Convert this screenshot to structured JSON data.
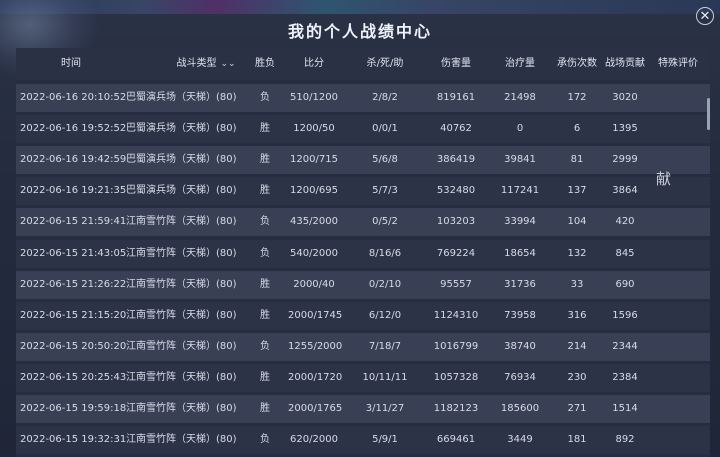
{
  "window": {
    "title": "我的个人战绩中心",
    "close_label": "✕"
  },
  "table": {
    "columns": {
      "time": "时间",
      "type": "战斗类型",
      "result": "胜负",
      "score": "比分",
      "kda": "杀/死/助",
      "damage": "伤害量",
      "heal": "治疗量",
      "taken": "承伤次数",
      "contribution": "战场贡献",
      "special": "特殊评价"
    },
    "sort_icon": "chevron-down-double-icon",
    "rows": [
      {
        "time": "2022-06-16 20:10:52",
        "type": "巴蜀演兵场（天梯）(80)",
        "result": "负",
        "score": "510/1200",
        "kda": "2/8/2",
        "damage": "819161",
        "heal": "21498",
        "taken": "172",
        "contribution": "3020",
        "special": ""
      },
      {
        "time": "2022-06-16 19:52:52",
        "type": "巴蜀演兵场（天梯）(80)",
        "result": "胜",
        "score": "1200/50",
        "kda": "0/0/1",
        "damage": "40762",
        "heal": "0",
        "taken": "6",
        "contribution": "1395",
        "special": ""
      },
      {
        "time": "2022-06-16 19:42:59",
        "type": "巴蜀演兵场（天梯）(80)",
        "result": "胜",
        "score": "1200/715",
        "kda": "5/6/8",
        "damage": "386419",
        "heal": "39841",
        "taken": "81",
        "contribution": "2999",
        "special": ""
      },
      {
        "time": "2022-06-16 19:21:35",
        "type": "巴蜀演兵场（天梯）(80)",
        "result": "胜",
        "score": "1200/695",
        "kda": "5/7/3",
        "damage": "532480",
        "heal": "117241",
        "taken": "137",
        "contribution": "3864",
        "special": ""
      },
      {
        "time": "2022-06-15 21:59:41",
        "type": "江南雪竹阵（天梯）(80)",
        "result": "负",
        "score": "435/2000",
        "kda": "0/5/2",
        "damage": "103203",
        "heal": "33994",
        "taken": "104",
        "contribution": "420",
        "special": ""
      },
      {
        "time": "2022-06-15 21:43:05",
        "type": "江南雪竹阵（天梯）(80)",
        "result": "负",
        "score": "540/2000",
        "kda": "8/16/6",
        "damage": "769224",
        "heal": "18654",
        "taken": "132",
        "contribution": "845",
        "special": ""
      },
      {
        "time": "2022-06-15 21:26:22",
        "type": "江南雪竹阵（天梯）(80)",
        "result": "胜",
        "score": "2000/40",
        "kda": "0/2/10",
        "damage": "95557",
        "heal": "31736",
        "taken": "33",
        "contribution": "690",
        "special": ""
      },
      {
        "time": "2022-06-15 21:15:20",
        "type": "江南雪竹阵（天梯）(80)",
        "result": "胜",
        "score": "2000/1745",
        "kda": "6/12/0",
        "damage": "1124310",
        "heal": "73958",
        "taken": "316",
        "contribution": "1596",
        "special": ""
      },
      {
        "time": "2022-06-15 20:50:20",
        "type": "江南雪竹阵（天梯）(80)",
        "result": "负",
        "score": "1255/2000",
        "kda": "7/18/7",
        "damage": "1016799",
        "heal": "38740",
        "taken": "214",
        "contribution": "2344",
        "special": ""
      },
      {
        "time": "2022-06-15 20:25:43",
        "type": "江南雪竹阵（天梯）(80)",
        "result": "胜",
        "score": "2000/1720",
        "kda": "10/11/11",
        "damage": "1057328",
        "heal": "76934",
        "taken": "230",
        "contribution": "2384",
        "special": ""
      },
      {
        "time": "2022-06-15 19:59:18",
        "type": "江南雪竹阵（天梯）(80)",
        "result": "胜",
        "score": "2000/1765",
        "kda": "3/11/27",
        "damage": "1182123",
        "heal": "185600",
        "taken": "271",
        "contribution": "1514",
        "special": ""
      },
      {
        "time": "2022-06-15 19:32:31",
        "type": "江南雪竹阵（天梯）(80)",
        "result": "负",
        "score": "620/2000",
        "kda": "5/9/1",
        "damage": "669461",
        "heal": "3449",
        "taken": "181",
        "contribution": "892",
        "special": ""
      }
    ]
  },
  "overlay_text": "献",
  "colors": {
    "background": "#242b3e",
    "row_even": "#394056",
    "row_odd": "#2c3346",
    "text": "#d6dbe6"
  }
}
